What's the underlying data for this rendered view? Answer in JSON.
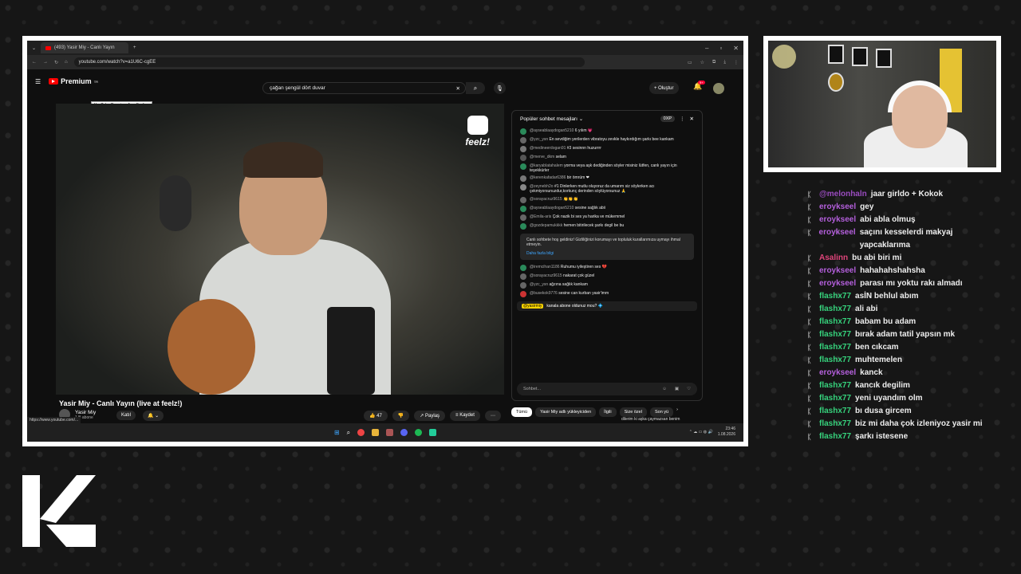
{
  "browser": {
    "tab_title": "(493) Yasir Miy - Canlı Yayın",
    "url": "youtube.com/watch?v=a1U6C-cgEE"
  },
  "youtube": {
    "logo_text": "Premium",
    "logo_sup": "TR",
    "tooltip": "YouTube Premium Ana Sayfası",
    "search_value": "çağan şengül dört duvar",
    "create_label": "Oluştur",
    "notif_count": "9+",
    "feelz_brand": "feelz!",
    "video_title": "Yasir Miy - Canlı Yayın (live at feelz!)",
    "channel_name": "Yasir Miy",
    "subscribers": "1 B abone",
    "join_label": "Katıl",
    "status_url": "https://www.youtube.com/...",
    "likes": "47",
    "share_label": "Paylaş",
    "save_label": "Kaydet",
    "chips": [
      "Tümü",
      "Yasir Miy adlı yükleyiciden",
      "İlgili",
      "Size özel",
      "Son yü"
    ],
    "peek_text": "dilerim ki aşka çaymazsan benim"
  },
  "live_chat": {
    "header": "Popüler sohbet mesajları",
    "points": "0XP",
    "messages": [
      {
        "user": "@ayseablaaydogan5210",
        "text": "6 yılım 💗",
        "color": "#2a8a5a"
      },
      {
        "user": "@yzc_ysn",
        "text": "En sevdiğim yerilerden vibratoyu zevkle haykırdığım şarkı bee kankam",
        "color": "#666"
      },
      {
        "user": "@medineerdogan91",
        "text": "#3 sesinnn huzurrrr",
        "color": "#777"
      },
      {
        "user": "@merve_dkm",
        "text": "selam",
        "color": "#555"
      },
      {
        "user": "@karyablatahalem",
        "text": "yorma veya aşk dediğinden söyler misiniz lütfen, canlı yayın için teşekkürler",
        "color": "#2a8a5a"
      },
      {
        "user": "@kerenkafadar6386",
        "text": "bir ömrüm ❤",
        "color": "#777"
      },
      {
        "user": "@zeynebh2o",
        "text": "#1 Dinlerken mutlu oluyoruz da umarım siz söylerken acı çekmiyorsunuzdur,korkunç derinden söylüyorsunuz 🙏",
        "color": "#888"
      },
      {
        "user": "@sorayacruz9615",
        "text": "👏👏👏",
        "color": "#666"
      },
      {
        "user": "@ayseablaaydogan5210",
        "text": "sesine sağlık abii",
        "color": "#2a8a5a"
      },
      {
        "user": "@Emila-aris",
        "text": "Çok nazik bi ses ya harika ve mükemmel",
        "color": "#666"
      },
      {
        "user": "@gozdepamukkkk",
        "text": "hemen bitirilecek şarkı degil be bu",
        "color": "#2a8a5a"
      }
    ],
    "notice_text": "Canlı sohbete hoş geldiniz! Gizliliğinizi korumayı ve topluluk kurallarımıza uymayı ihmal etmeyin.",
    "notice_link": "Daha fazla bilgi",
    "messages2": [
      {
        "user": "@iremcihan1186",
        "text": "Ruhumu iyileştiren ses 💔",
        "color": "#2a8a5a"
      },
      {
        "user": "@sorayacruz9615",
        "text": "nakarat çok güzel",
        "color": "#666"
      },
      {
        "user": "@yzc_ysn",
        "text": "ağzına sağlık kankam",
        "color": "#666"
      },
      {
        "user": "@busekok9776",
        "text": "sesine can kurban yasir'imm",
        "color": "#c33"
      }
    ],
    "pinned_user": "@yasirmiy",
    "pinned_text": "kanala abone oldunuz mou? 💠",
    "input_placeholder": "Sohbet..."
  },
  "taskbar": {
    "time": "23:46",
    "date": "1.08.2026"
  },
  "twitch_chat": [
    {
      "name": "@melonhaln",
      "text": "jaar girldo + Kokok",
      "color": "#9a4cbf"
    },
    {
      "name": "eroykseel",
      "text": "gey",
      "color": "#b45fdc"
    },
    {
      "name": "eroykseel",
      "text": "abi abla olmuş",
      "color": "#b45fdc"
    },
    {
      "name": "eroykseel",
      "text": "saçını kesselerdi makyaj yapcaklarıma",
      "color": "#b45fdc"
    },
    {
      "name": "Asalinn",
      "text": "bu abi biri mi",
      "color": "#e0457b"
    },
    {
      "name": "eroykseel",
      "text": "hahahahshahsha",
      "color": "#b45fdc"
    },
    {
      "name": "eroykseel",
      "text": "parası mı yoktu rakı almadı",
      "color": "#b45fdc"
    },
    {
      "name": "flashx77",
      "text": "asİN behlul abım",
      "color": "#36d27c"
    },
    {
      "name": "flashx77",
      "text": "ali abi",
      "color": "#36d27c"
    },
    {
      "name": "flashx77",
      "text": "babam bu adam",
      "color": "#36d27c"
    },
    {
      "name": "flashx77",
      "text": "bırak adam tatil yapsın mk",
      "color": "#36d27c"
    },
    {
      "name": "flashx77",
      "text": "ben cıkcam",
      "color": "#36d27c"
    },
    {
      "name": "flashx77",
      "text": "muhtemelen",
      "color": "#36d27c"
    },
    {
      "name": "eroykseel",
      "text": "kanck",
      "color": "#b45fdc"
    },
    {
      "name": "flashx77",
      "text": "kancık degilim",
      "color": "#36d27c"
    },
    {
      "name": "flashx77",
      "text": "yeni uyandım olm",
      "color": "#36d27c"
    },
    {
      "name": "flashx77",
      "text": "bı dusa gircem",
      "color": "#36d27c"
    },
    {
      "name": "flashx77",
      "text": "biz mi daha çok izleniyoz yasir mi",
      "color": "#36d27c"
    },
    {
      "name": "flashx77",
      "text": "şarkı istesene",
      "color": "#36d27c"
    }
  ]
}
